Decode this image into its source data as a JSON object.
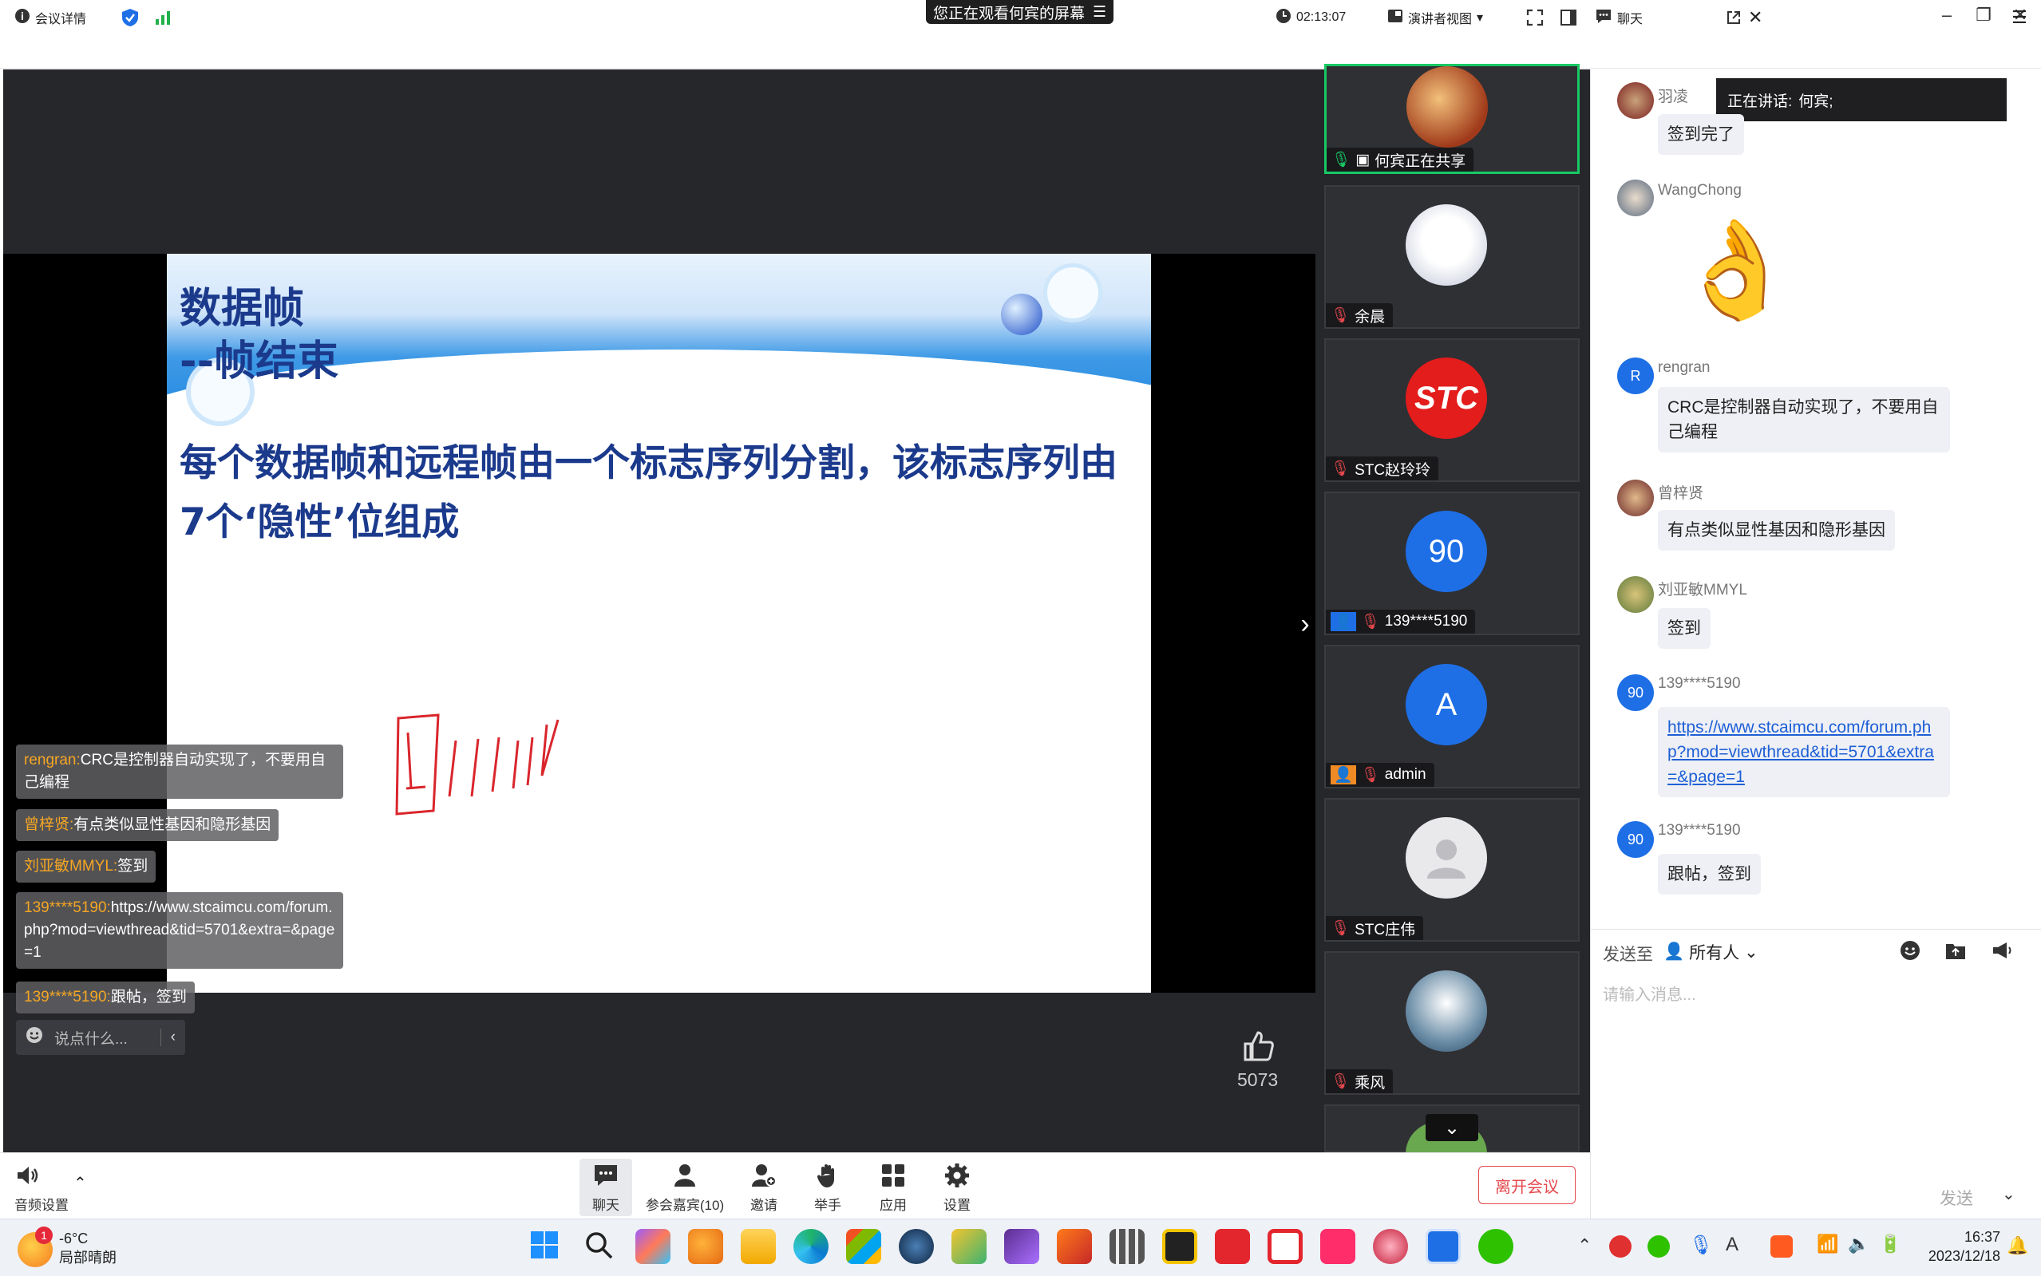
{
  "banner": {
    "text": "您正在观看何宾的屏幕"
  },
  "toolbar": {
    "meeting_info": "会议详情",
    "timer": "02:13:07",
    "view_mode": "演讲者视图",
    "chat_label": "聊天"
  },
  "slide": {
    "title_line1": "数据帧",
    "title_line2": "--帧结束",
    "body_line1": "每个数据帧和远程帧由一个标志序列分割，该标志序列由",
    "body_line2": "7个‘隐性’位组成"
  },
  "overlay_chat": {
    "messages": [
      {
        "name": "rengran:",
        "text": "CRC是控制器自动实现了，不要用自己编程"
      },
      {
        "name": "曾梓贤:",
        "text": "有点类似显性基因和隐形基因"
      },
      {
        "name": "刘亚敏MMYL:",
        "text": "签到"
      },
      {
        "name": "139****5190:",
        "text": "https://www.stcaimcu.com/forum.php?mod=viewthread&tid=5701&extra=&page=1"
      },
      {
        "name": "139****5190:",
        "text": "跟帖，签到"
      }
    ],
    "input_placeholder": "说点什么..."
  },
  "likes": {
    "count": "5073"
  },
  "gallery": {
    "tiles": [
      {
        "name": "何宾正在共享",
        "avatar": "photo-red",
        "active": true
      },
      {
        "name": "余晨",
        "avatar": "anime"
      },
      {
        "name": "STC赵玲玲",
        "avatar": "stc-logo",
        "avatar_text": "STC"
      },
      {
        "name": "139****5190",
        "avatar": "number",
        "avatar_text": "90"
      },
      {
        "name": "admin",
        "avatar": "letter",
        "avatar_text": "A"
      },
      {
        "name": "STC庄伟",
        "avatar": "default-person"
      },
      {
        "name": "乘风",
        "avatar": "ship"
      }
    ]
  },
  "speaking": {
    "label": "正在讲话:",
    "name": "何宾;"
  },
  "chat": {
    "messages": [
      {
        "sender": "羽凌",
        "text": "签到完了",
        "avatar": "photo"
      },
      {
        "sender": "WangChong",
        "text": "",
        "emoji": "👌",
        "avatar": "photo"
      },
      {
        "sender": "rengran",
        "text": "CRC是控制器自动实现了，不要用自己编程",
        "avatar": "R"
      },
      {
        "sender": "曾梓贤",
        "text": "有点类似显性基因和隐形基因",
        "avatar": "photo"
      },
      {
        "sender": "刘亚敏MMYL",
        "text": "签到",
        "avatar": "photo"
      },
      {
        "sender": "139****5190",
        "text": "https://www.stcaimcu.com/forum.php?mod=viewthread&tid=5701&extra=&page=1",
        "avatar": "90",
        "link": true
      },
      {
        "sender": "139****5190",
        "text": "跟帖，签到",
        "avatar": "90"
      }
    ],
    "send_to_label": "发送至",
    "send_to_value": "所有人",
    "input_placeholder": "请输入消息...",
    "send_button": "发送"
  },
  "bottombar": {
    "audio_settings": "音频设置",
    "chat": "聊天",
    "participants": "参会嘉宾(10)",
    "invite": "邀请",
    "raise_hand": "举手",
    "apps": "应用",
    "settings": "设置",
    "leave": "离开会议"
  },
  "taskbar": {
    "weather_temp": "-6°C",
    "weather_desc": "局部晴朗",
    "weather_badge": "1",
    "time": "16:37",
    "date": "2023/12/18"
  },
  "colors": {
    "accent": "#1e6fe6",
    "active_border": "#17c964",
    "leave_red": "#e5484d",
    "overlay_name": "#f5a623"
  }
}
